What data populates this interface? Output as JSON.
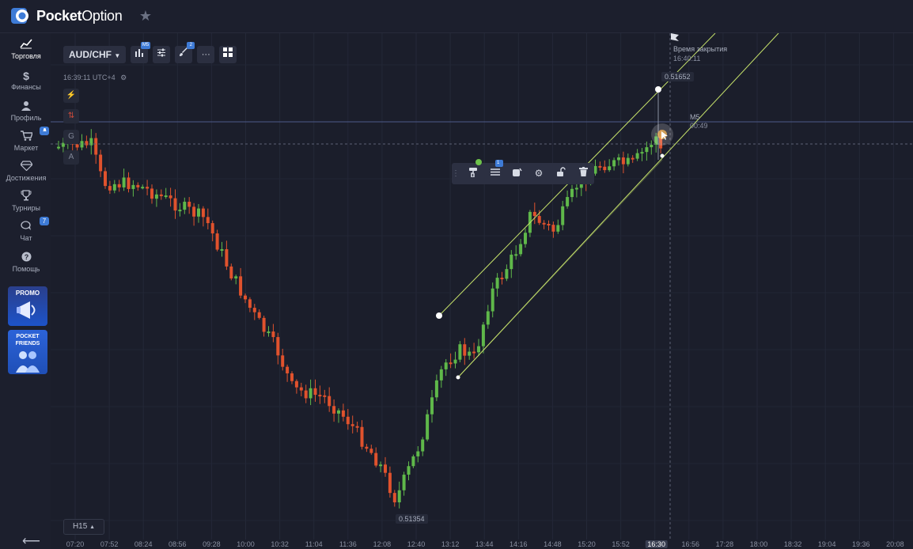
{
  "app": {
    "brand_bold": "Pocket",
    "brand_light": "Option"
  },
  "sidebar": {
    "items": [
      {
        "label": "Торговля",
        "icon": "chart-line-icon"
      },
      {
        "label": "Финансы",
        "icon": "dollar-icon"
      },
      {
        "label": "Профиль",
        "icon": "user-icon"
      },
      {
        "label": "Маркет",
        "icon": "cart-icon"
      },
      {
        "label": "Достижения",
        "icon": "diamond-icon"
      },
      {
        "label": "Турниры",
        "icon": "trophy-icon"
      },
      {
        "label": "Чат",
        "icon": "chat-icon"
      },
      {
        "label": "Помощь",
        "icon": "help-icon"
      }
    ],
    "chat_badge": "7",
    "promo_label": "PROMO",
    "friends_label_1": "POCKET",
    "friends_label_2": "FRIENDS"
  },
  "toolbar": {
    "pair": "AUD/CHF",
    "indicator_badge": "M5",
    "drawing_badge": "2",
    "more_label": "···"
  },
  "chart": {
    "clock": "16:39:11 UTC+4",
    "close_label": "Время закрытия",
    "close_time": "16:40:11",
    "high_price": "0.51652",
    "low_price": "0.51354",
    "period_label": "M5",
    "countdown": "00:49",
    "timeframe": "H15",
    "layers_badge": "1",
    "vtools": [
      "G",
      "A"
    ]
  },
  "time_axis": {
    "labels": [
      "07:20",
      "07:52",
      "08:24",
      "08:56",
      "09:28",
      "10:00",
      "10:32",
      "11:04",
      "11:36",
      "12:08",
      "12:40",
      "13:12",
      "13:44",
      "14:16",
      "14:48",
      "15:20",
      "15:52",
      "16:30",
      "16:56",
      "17:28",
      "18:00",
      "18:32",
      "19:04",
      "19:36",
      "20:08"
    ],
    "current": "16:30"
  },
  "colors": {
    "up": "#5fb84a",
    "down": "#e0522d",
    "channel": "#c7e36b",
    "accent": "#3e7bd6"
  }
}
